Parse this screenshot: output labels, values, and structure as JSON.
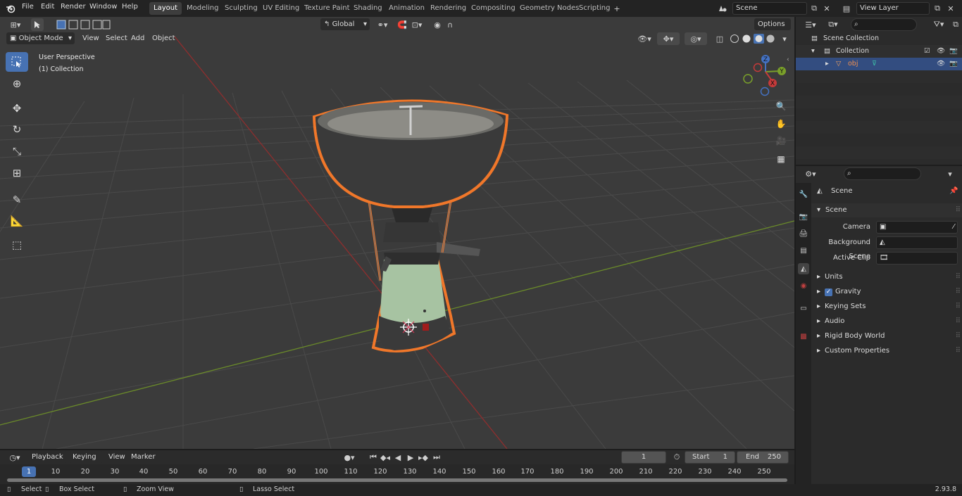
{
  "menu": {
    "items": [
      "File",
      "Edit",
      "Render",
      "Window",
      "Help"
    ]
  },
  "workspaces": {
    "tabs": [
      "Layout",
      "Modeling",
      "Sculpting",
      "UV Editing",
      "Texture Paint",
      "Shading",
      "Animation",
      "Rendering",
      "Compositing",
      "Geometry Nodes",
      "Scripting"
    ],
    "active": "Layout"
  },
  "scene_field": "Scene",
  "view_layer_field": "View Layer",
  "viewport": {
    "mode": "Object Mode",
    "menus": [
      "View",
      "Select",
      "Add",
      "Object"
    ],
    "orientation": "Global",
    "options_label": "Options",
    "overlay_title": "User Perspective",
    "overlay_collection": "(1) Collection",
    "gizmo_axes": {
      "z": "Z",
      "y": "Y",
      "x": "X"
    }
  },
  "outliner": {
    "rows": [
      {
        "label": "Scene Collection"
      },
      {
        "label": "Collection"
      },
      {
        "label": "obj"
      }
    ]
  },
  "properties": {
    "header": "Scene",
    "panel": "Scene",
    "fields": [
      {
        "label": "Camera",
        "value": ""
      },
      {
        "label": "Background Scene",
        "value": ""
      },
      {
        "label": "Active Clip",
        "value": ""
      }
    ],
    "sections": [
      "Units",
      "Gravity",
      "Keying Sets",
      "Audio",
      "Rigid Body World",
      "Custom Properties"
    ],
    "gravity_checked": true
  },
  "timeline": {
    "menus": [
      "Playback",
      "Keying",
      "View",
      "Marker"
    ],
    "current_frame": "1",
    "start_label": "Start",
    "start_value": "1",
    "end_label": "End",
    "end_value": "250",
    "ruler": [
      "1",
      "10",
      "20",
      "30",
      "40",
      "50",
      "60",
      "70",
      "80",
      "90",
      "100",
      "110",
      "120",
      "130",
      "140",
      "150",
      "160",
      "170",
      "180",
      "190",
      "200",
      "210",
      "220",
      "230",
      "240",
      "250"
    ]
  },
  "statusbar": {
    "items": [
      "Select",
      "Box Select",
      "Zoom View",
      "Lasso Select"
    ],
    "version": "2.93.8"
  },
  "colors": {
    "accent": "#4772b3",
    "selection": "#f0772a",
    "x_axis": "#a13535",
    "y_axis": "#7a9a2c"
  }
}
